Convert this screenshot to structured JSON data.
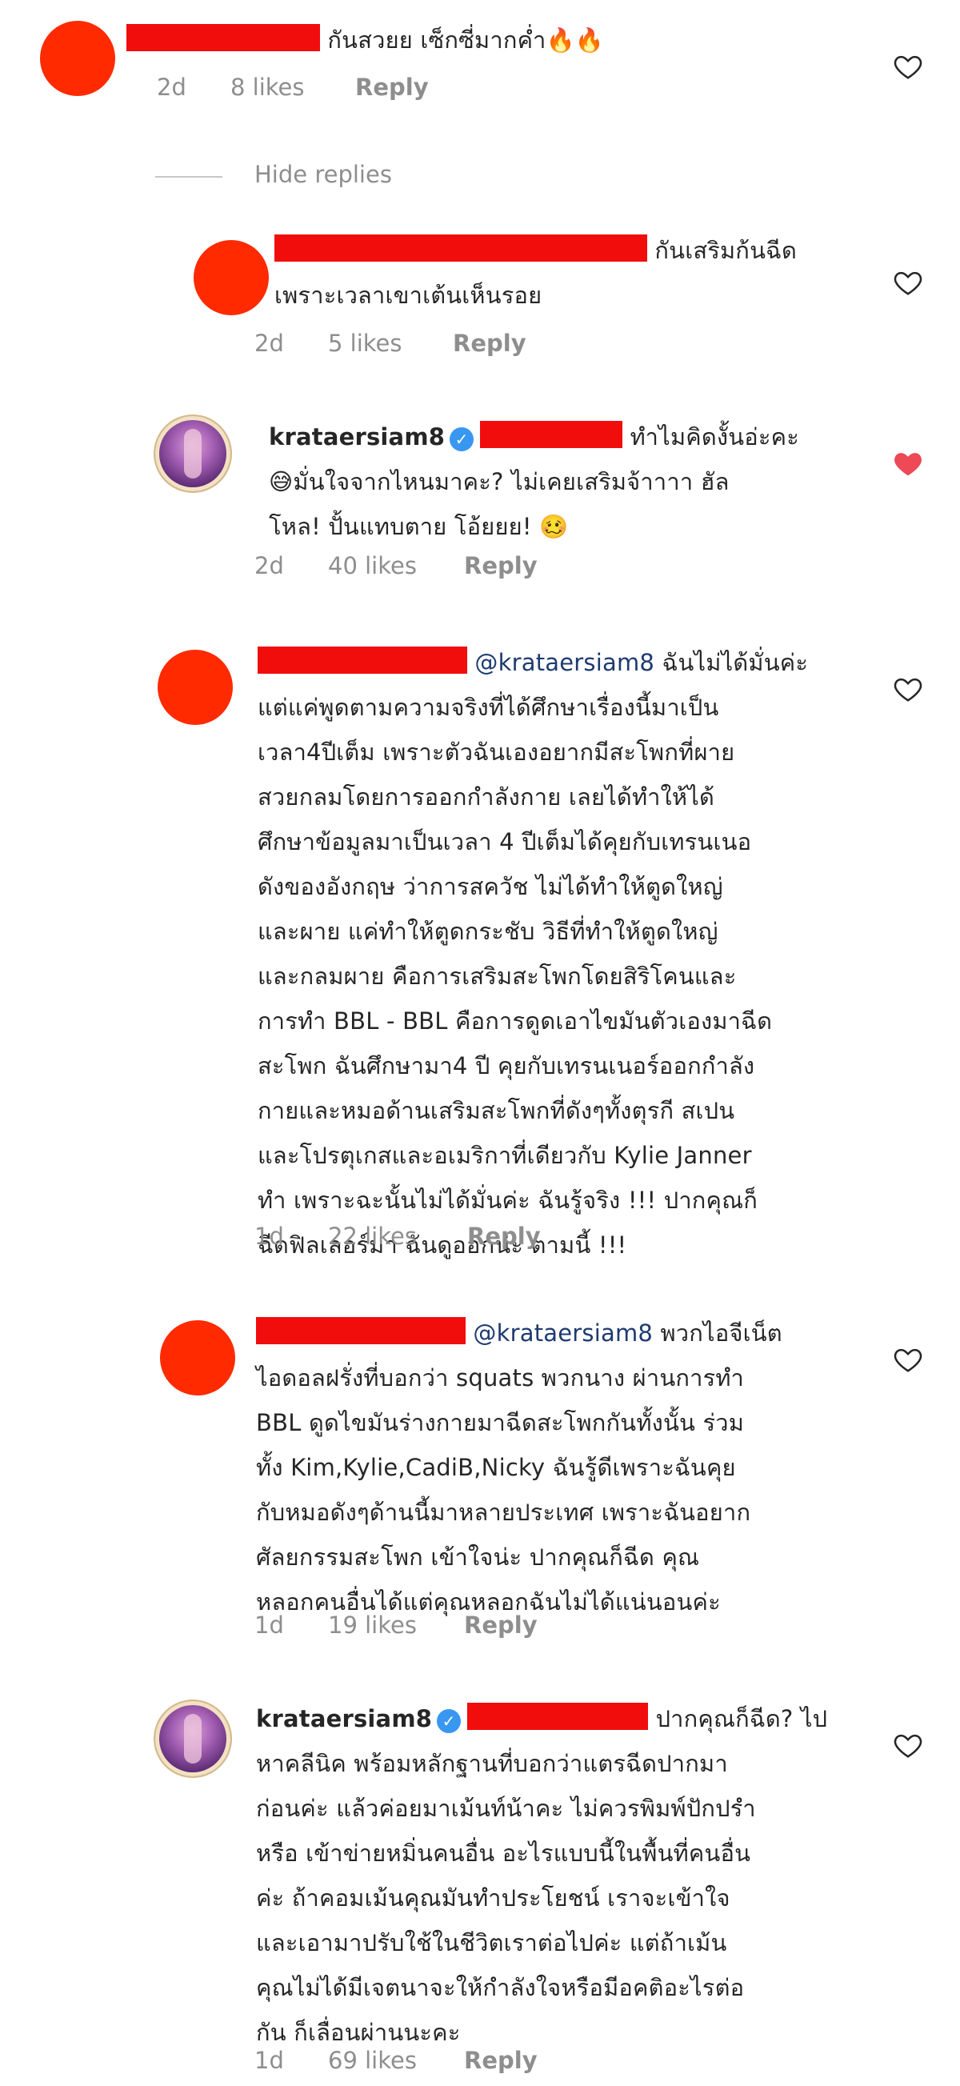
{
  "colors": {
    "redaction": "#f20d0d",
    "liked_heart": "#ed4956",
    "verified": "#3897f0"
  },
  "hide_replies": "Hide replies",
  "comments": [
    {
      "lines": [
        "กันสวยย เซ็กซี่มากค่ำ🔥🔥"
      ],
      "time": "2d",
      "likes": "8 likes",
      "reply": "Reply",
      "liked": false
    },
    {
      "lines": [
        "กันเสริมก้นฉีด",
        "เพราะเวลาเขาเต้นเห็นรอย"
      ],
      "time": "2d",
      "likes": "5 likes",
      "reply": "Reply",
      "liked": false
    },
    {
      "username": "krataersiam8",
      "lines": [
        "ทำไมคิดงั้นอ่ะคะ",
        "😅มั่นใจจากไหนมาคะ? ไม่เคยเสริมจ้าาาา ฮัล",
        "โหล! ปั้นแทบตาย โอ้ยยย! 🥴"
      ],
      "time": "2d",
      "likes": "40 likes",
      "reply": "Reply",
      "liked": true
    },
    {
      "mention": "@krataersiam8",
      "lines": [
        "ฉันไม่ได้มั่นค่ะ",
        "แต่แค่พูดตามความจริงที่ได้ศึกษาเรื่องนี้มาเป็น",
        "เวลา4ปีเต็ม เพราะตัวฉันเองอยากมีสะโพกที่ผาย",
        "สวยกลมโดยการออกกำลังกาย เลยได้ทำให้ได้",
        "ศึกษาข้อมูลมาเป็นเวลา 4 ปีเต็มได้คุยกับเทรนเนอ",
        "ดังของอังกฤษ ว่าการสควัช ไม่ได้ทำให้ตูดใหญ่",
        "และผาย แค่ทำให้ตูดกระชับ วิธีที่ทำให้ตูดใหญ่",
        "และกลมผาย คือการเสริมสะโพกโดยสิริโคนและ",
        "การทำ BBL - BBL คือการดูดเอาไขมันตัวเองมาฉีด",
        "สะโพก ฉันศึกษามา4 ปี คุยกับเทรนเนอร์ออกกำลัง",
        "กายและหมอด้านเสริมสะโพกที่ดังๆทั้งตุรกี สเปน",
        "และโปรตุเกสและอเมริกาที่เดียวกับ Kylie Janner",
        "ทำ เพราะฉะนั้นไม่ได้มั่นค่ะ ฉันรู้จริง !!! ปากคุณก็",
        "ฉีดฟิลเลอร์มา ฉันดูออกน่ะ ตามนี้ !!!"
      ],
      "time": "1d",
      "likes": "22 likes",
      "reply": "Reply",
      "liked": false
    },
    {
      "mention": "@krataersiam8",
      "lines": [
        "พวกไอจีเน็ต",
        "ไอดอลฝรั่งที่บอกว่า squats พวกนาง ผ่านการทำ",
        "BBL ดูดไขมันร่างกายมาฉีดสะโพกกันทั้งนั้น ร่วม",
        "ทั้ง Kim,Kylie,CadiB,Nicky ฉันรู้ดีเพราะฉันคุย",
        "กับหมอดังๆด้านนี้มาหลายประเทศ เพราะฉันอยาก",
        "ศัลยกรรมสะโพก เข้าใจน่ะ ปากคุณก็ฉีด คุณ",
        "หลอกคนอื่นได้แต่คุณหลอกฉันไม่ได้แน่นอนค่ะ"
      ],
      "time": "1d",
      "likes": "19 likes",
      "reply": "Reply",
      "liked": false
    },
    {
      "username": "krataersiam8",
      "lines": [
        "ปากคุณก็ฉีด? ไป",
        "หาคลีนิค พร้อมหลักฐานที่บอกว่าแตรฉีดปากมา",
        "ก่อนค่ะ แล้วค่อยมาเม้นท์น้าคะ ไม่ควรพิมพ์ปักปรำ",
        "หรือ เข้าข่ายหมิ่นคนอื่น อะไรแบบนี้ในพื้นที่คนอื่น",
        "ค่ะ ถ้าคอมเม้นคุณมันทำประโยชน์ เราจะเข้าใจ",
        "และเอามาปรับใช้ในชีวิตเราต่อไปค่ะ แต่ถ้าเม้น",
        "คุณไม่ได้มีเจตนาจะให้กำลังใจหรือมีอคติอะไรต่อ",
        "กัน ก็เลื่อนผ่านนะคะ"
      ],
      "time": "1d",
      "likes": "69 likes",
      "reply": "Reply",
      "liked": false
    }
  ]
}
